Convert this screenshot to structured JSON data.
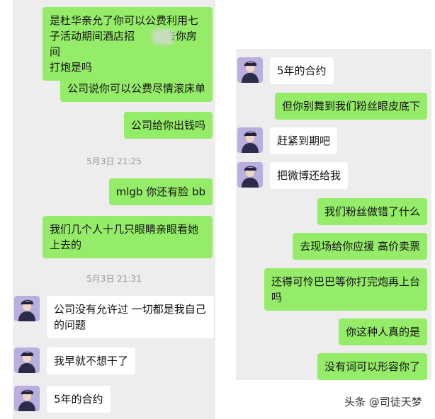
{
  "left": {
    "messages": [
      {
        "text": "是杜华亲允了你可以公费利用七\n子活动期间酒店招         去你房间\n打炮是吗",
        "side": "me"
      },
      {
        "text": "公司说你可以公费尽情滚床单",
        "side": "me"
      },
      {
        "text": "公司给你出钱吗",
        "side": "me"
      },
      {
        "text": "mlgb 你还有脸 bb",
        "side": "me"
      },
      {
        "text": "我们几个人十几只眼睛亲眼看她\n上去的",
        "side": "me"
      },
      {
        "text": "公司没有允许过 一切都是我自己\n的问题",
        "side": "other"
      },
      {
        "text": "我早就不想干了",
        "side": "other"
      },
      {
        "text": "5年的合约",
        "side": "other"
      }
    ],
    "timestamps": [
      "5月3日 21:25",
      "5月3日 21:31"
    ]
  },
  "right": {
    "messages": [
      {
        "text": "5年的合约",
        "side": "other"
      },
      {
        "text": "但你别舞到我们粉丝眼皮底下",
        "side": "me"
      },
      {
        "text": "赶紧到期吧",
        "side": "other"
      },
      {
        "text": "把微博还给我",
        "side": "other"
      },
      {
        "text": "我们粉丝做错了什么",
        "side": "me"
      },
      {
        "text": "去现场给你应援 高价卖票",
        "side": "me"
      },
      {
        "text": "还得可怜巴巴等你打完炮再上台\n吗",
        "side": "me"
      },
      {
        "text": "你这种人真的是",
        "side": "me"
      },
      {
        "text": "没有词可以形容你了",
        "side": "me"
      }
    ]
  },
  "watermark": "头条 @司徒天梦",
  "colors": {
    "sent_bubble": "#95ec69",
    "received_bubble": "#ffffff",
    "chat_bg": "#ededed",
    "avatar_bg": "#b9aede"
  }
}
